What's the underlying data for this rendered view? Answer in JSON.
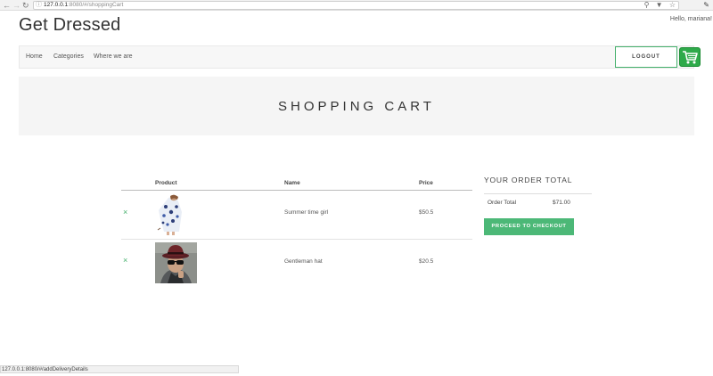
{
  "browser": {
    "back_icon": "arrow-left-icon",
    "forward_icon": "arrow-right-icon",
    "reload_icon": "reload-icon",
    "url_host": "127.0.0.1",
    "url_path": ":8080/#/shoppingCart",
    "status_url": "127.0.0.1:8080/#/addDeliveryDetails"
  },
  "header": {
    "brand": "Get Dressed",
    "greeting": "Hello, mariana!"
  },
  "nav": {
    "items": [
      {
        "label": "Home"
      },
      {
        "label": "Categories"
      },
      {
        "label": "Where we are"
      }
    ],
    "logout_label": "LOGOUT",
    "cart_icon": "shopping-cart-icon",
    "accent_color": "#2eaa4a"
  },
  "page": {
    "title": "SHOPPING CART"
  },
  "cart": {
    "columns": [
      "Product",
      "Name",
      "Price"
    ],
    "remove_symbol": "×",
    "items": [
      {
        "name": "Summer time girl",
        "price": "$50.5"
      },
      {
        "name": "Gentleman hat",
        "price": "$20.5"
      }
    ]
  },
  "order": {
    "title": "YOUR ORDER TOTAL",
    "total_label": "Order Total",
    "total_value": "$71.00",
    "checkout_label": "PROCEED TO CHECKOUT",
    "button_color": "#4cb877"
  }
}
